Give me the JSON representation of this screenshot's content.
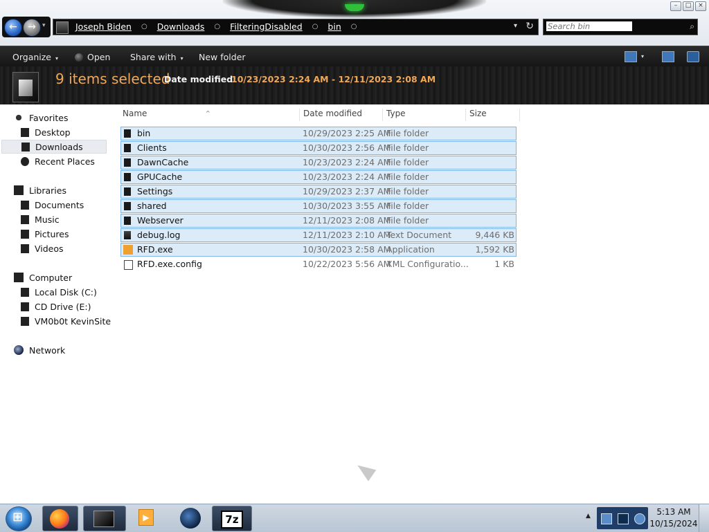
{
  "window": {
    "controls": {
      "minimize": "–",
      "maximize": "□",
      "close": "×"
    }
  },
  "navigation": {
    "back_glyph": "←",
    "forward_glyph": "→",
    "history_glyph": "▾"
  },
  "address": {
    "crumbs": [
      "Joseph Biden",
      "Downloads",
      "FilteringDisabled",
      "bin"
    ],
    "dropdown_glyph": "▾",
    "refresh_glyph": "↻"
  },
  "search": {
    "placeholder": "Search bin",
    "icon_glyph": "⌕"
  },
  "toolbar": {
    "organize": "Organize",
    "open": "Open",
    "share_with": "Share with",
    "new_folder": "New folder",
    "caret": "▾"
  },
  "details": {
    "selection_count": "9 items selected",
    "date_label": "Date modified:",
    "date_range": "10/23/2023 2:24 AM - 12/11/2023 2:08 AM"
  },
  "nav_pane": {
    "favorites": {
      "label": "Favorites",
      "items": [
        "Desktop",
        "Downloads",
        "Recent Places"
      ]
    },
    "libraries": {
      "label": "Libraries",
      "items": [
        "Documents",
        "Music",
        "Pictures",
        "Videos"
      ]
    },
    "computer": {
      "label": "Computer",
      "items": [
        "Local Disk (C:)",
        "CD Drive (E:)",
        "VM0b0t KevinSite"
      ]
    },
    "network": {
      "label": "Network"
    },
    "selected": "Downloads"
  },
  "columns": {
    "name": "Name",
    "date": "Date modified",
    "type": "Type",
    "size": "Size",
    "sort_glyph": "^"
  },
  "files": [
    {
      "name": "bin",
      "date": "10/29/2023 2:25 AM",
      "type": "File folder",
      "size": "",
      "kind": "folder",
      "selected": true
    },
    {
      "name": "Clients",
      "date": "10/30/2023 2:56 AM",
      "type": "File folder",
      "size": "",
      "kind": "folder",
      "selected": true
    },
    {
      "name": "DawnCache",
      "date": "10/23/2023 2:24 AM",
      "type": "File folder",
      "size": "",
      "kind": "folder",
      "selected": true
    },
    {
      "name": "GPUCache",
      "date": "10/23/2023 2:24 AM",
      "type": "File folder",
      "size": "",
      "kind": "folder",
      "selected": true
    },
    {
      "name": "Settings",
      "date": "10/29/2023 2:37 AM",
      "type": "File folder",
      "size": "",
      "kind": "folder",
      "selected": true
    },
    {
      "name": "shared",
      "date": "10/30/2023 3:55 AM",
      "type": "File folder",
      "size": "",
      "kind": "folder",
      "selected": true
    },
    {
      "name": "Webserver",
      "date": "12/11/2023 2:08 AM",
      "type": "File folder",
      "size": "",
      "kind": "folder",
      "selected": true
    },
    {
      "name": "debug.log",
      "date": "12/11/2023 2:10 AM",
      "type": "Text Document",
      "size": "9,446 KB",
      "kind": "log",
      "selected": true
    },
    {
      "name": "RFD.exe",
      "date": "10/30/2023 2:58 AM",
      "type": "Application",
      "size": "1,592 KB",
      "kind": "exe",
      "selected": true
    },
    {
      "name": "RFD.exe.config",
      "date": "10/22/2023 5:56 AM",
      "type": "XML Configuratio...",
      "size": "1 KB",
      "kind": "cfg",
      "selected": false
    }
  ],
  "taskbar": {
    "apps": [
      "firefox",
      "explorer",
      "media-player",
      "globe",
      "7-zip"
    ],
    "tray_expand_glyph": "▲",
    "time": "5:13 AM",
    "date": "10/15/2024"
  }
}
